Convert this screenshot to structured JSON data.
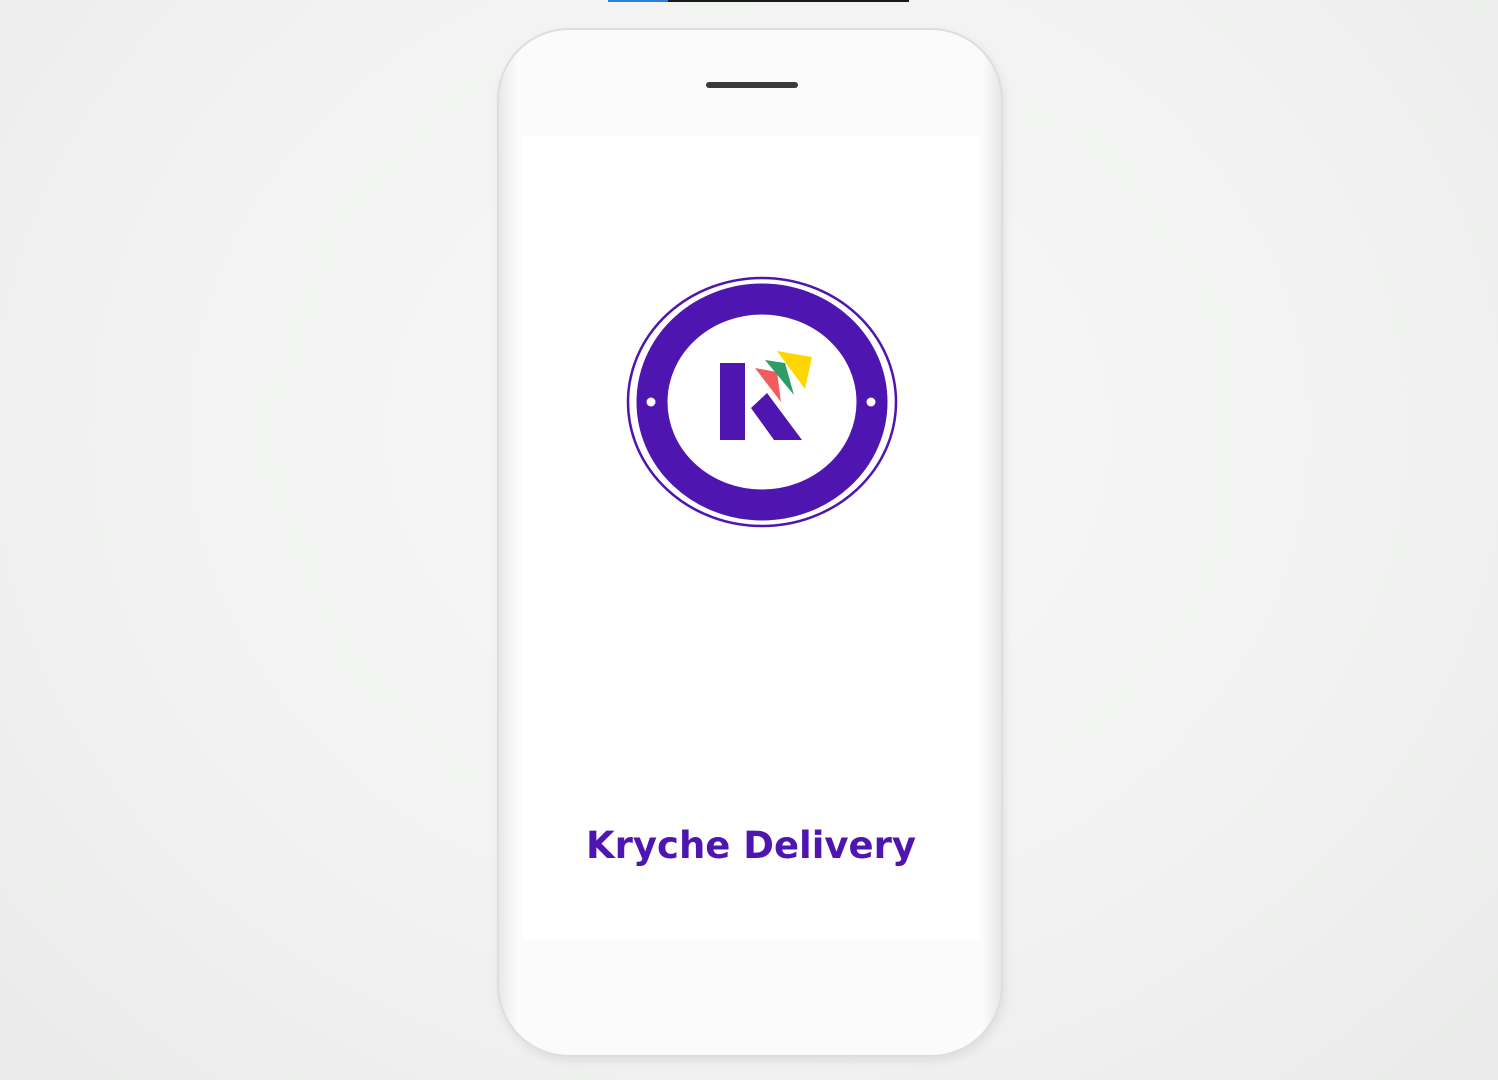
{
  "loading_bar": {
    "progress_percent": 20,
    "fill_color": "#2a7de1"
  },
  "app": {
    "title": "Kryche Delivery",
    "brand_color": "#4f15b0"
  },
  "logo": {
    "letter": "K",
    "accent_colors": [
      "#f25c5c",
      "#2f9e66",
      "#ffd700"
    ]
  }
}
